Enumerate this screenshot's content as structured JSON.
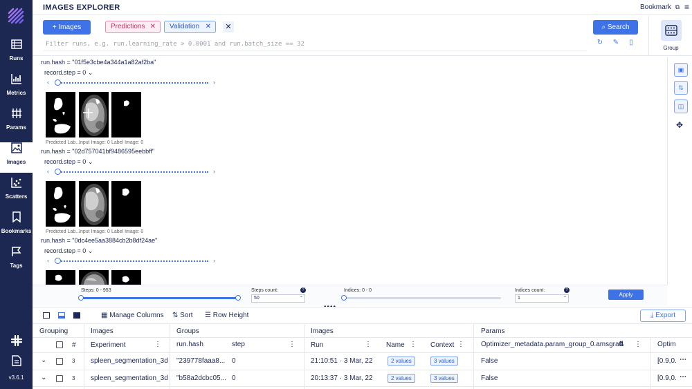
{
  "app": {
    "title": "IMAGES EXPLORER",
    "bookmark_label": "Bookmark",
    "version": "v3.6.1"
  },
  "nav": [
    {
      "label": "Runs",
      "icon": "runs-icon"
    },
    {
      "label": "Metrics",
      "icon": "metrics-icon"
    },
    {
      "label": "Params",
      "icon": "params-icon"
    },
    {
      "label": "Images",
      "icon": "images-icon",
      "active": true
    },
    {
      "label": "Scatters",
      "icon": "scatters-icon"
    },
    {
      "label": "Bookmarks",
      "icon": "bookmarks-icon"
    },
    {
      "label": "Tags",
      "icon": "tags-icon"
    }
  ],
  "query": {
    "images_button": "Images",
    "chips": [
      "Predictions",
      "Validation"
    ],
    "search_button": "Search",
    "filter_placeholder": "Filter runs, e.g. run.learning_rate > 0.0001 and run.batch_size == 32"
  },
  "group": {
    "label": "Group"
  },
  "runs": [
    {
      "hash": "run.hash = \"01f5e3cbe4a344a1a82af2ba\"",
      "step": "record.step = 0",
      "captions": [
        "Predicted Lab...",
        "Input Image: 0",
        "Label Image: 0"
      ]
    },
    {
      "hash": "run.hash = \"02d757041bf9486595eebbff\"",
      "step": "record.step = 0",
      "captions": [
        "Predicted Lab...",
        "Input Image: 0",
        "Label Image: 0"
      ]
    },
    {
      "hash": "run.hash = \"0dc4ee5aa3884cb2b8df24ae\"",
      "step": "record.step = 0",
      "captions": []
    }
  ],
  "controls": {
    "steps_label": "Steps: 0 - 953",
    "steps_count_label": "Steps count:",
    "steps_count_value": "50",
    "indices_label": "Indices: 0 - 0",
    "indices_count_label": "Indices count:",
    "indices_count_value": "1",
    "apply": "Apply"
  },
  "table_toolbar": {
    "manage_columns": "Manage Columns",
    "sort": "Sort",
    "row_height": "Row Height",
    "export": "Export"
  },
  "table": {
    "groups": {
      "grouping": "Grouping",
      "images": "Images",
      "groups": "Groups",
      "images2": "Images",
      "params": "Params"
    },
    "columns": {
      "index": "#",
      "experiment": "Experiment",
      "run_hash": "run.hash",
      "step": "step",
      "run": "Run",
      "name": "Name",
      "context": "Context",
      "opt": "Optimizer_metadata.param_group_0.amsgrad",
      "opt2": "Optim"
    },
    "rows": [
      {
        "count": "3",
        "experiment": "spleen_segmentation_3d",
        "hash": "\"239778faaa8...",
        "step": "0",
        "run": "21:10:51 · 3 Mar, 22",
        "name": "2 values",
        "context": "3 values",
        "opt": "False",
        "opt2": "[0.9,0."
      },
      {
        "count": "3",
        "experiment": "spleen_segmentation_3d",
        "hash": "\"b58a2dcbc05...",
        "step": "0",
        "run": "20:13:37 · 3 Mar, 22",
        "name": "2 values",
        "context": "3 values",
        "opt": "False",
        "opt2": "[0.9,0."
      }
    ]
  },
  "colors": {
    "sidebar": "#1c2852",
    "accent": "#3e72e7",
    "predictions": "#cc2f6a"
  }
}
